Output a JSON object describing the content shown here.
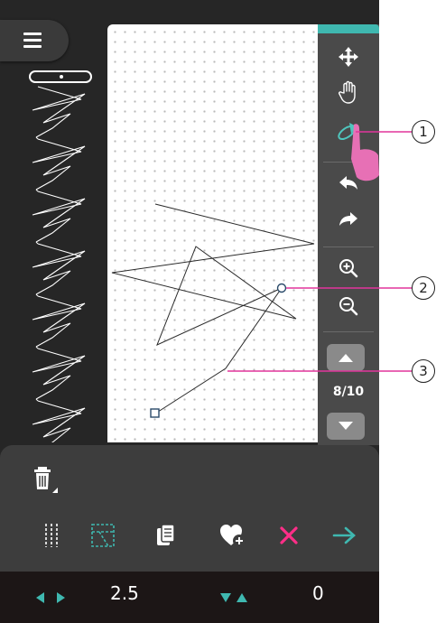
{
  "toolbar": {
    "page_indicator": "8/10",
    "tools": [
      "move-icon",
      "pan-hand-icon",
      "select-stitch-icon",
      "undo-icon",
      "redo-icon",
      "zoom-in-icon",
      "zoom-out-icon"
    ],
    "accent_color": "#3fb8b0"
  },
  "status": {
    "stitch_width_value": "2.5",
    "stitch_length_value": "0",
    "arrow_color": "#3fb8b0"
  },
  "actions": {
    "icons": [
      "triple-stitch-icon",
      "select-points-icon",
      "duplicate-icon",
      "add-to-favorites-icon",
      "delete-point-icon",
      "confirm-arrow-icon"
    ],
    "delete_color": "#ff2e88",
    "confirm_color": "#3fb8b0"
  },
  "callouts": {
    "one": "1",
    "two": "2",
    "three": "3"
  },
  "colors": {
    "pointer_hand": "#e770b5",
    "callout_line": "#e2359c"
  }
}
